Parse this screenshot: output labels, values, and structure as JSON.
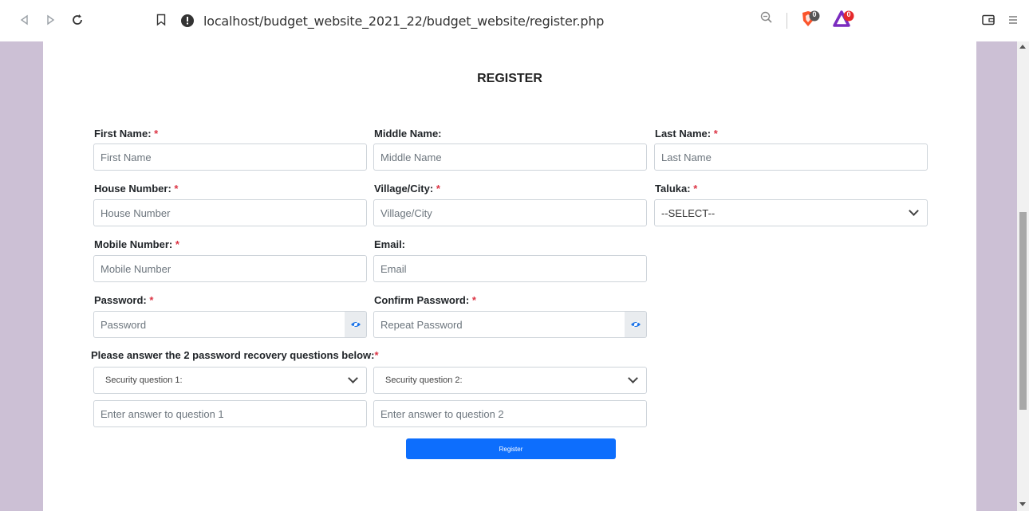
{
  "browser": {
    "url": "localhost/budget_website_2021_22/budget_website/register.php",
    "shield_badge": "0",
    "rewards_badge": "0"
  },
  "page": {
    "title": "REGISTER",
    "required_mark": "*"
  },
  "form": {
    "first_name": {
      "label": "First Name:",
      "placeholder": "First Name",
      "required": true
    },
    "middle_name": {
      "label": "Middle Name:",
      "placeholder": "Middle Name",
      "required": false
    },
    "last_name": {
      "label": "Last Name:",
      "placeholder": "Last Name",
      "required": true
    },
    "house_number": {
      "label": "House Number:",
      "placeholder": "House Number",
      "required": true
    },
    "village_city": {
      "label": "Village/City:",
      "placeholder": "Village/City",
      "required": true
    },
    "taluka": {
      "label": "Taluka:",
      "selected": "--SELECT--",
      "required": true
    },
    "mobile_number": {
      "label": "Mobile Number:",
      "placeholder": "Mobile Number",
      "required": true
    },
    "email": {
      "label": "Email:",
      "placeholder": "Email",
      "required": false
    },
    "password": {
      "label": "Password:",
      "placeholder": "Password",
      "required": true
    },
    "confirm_password": {
      "label": "Confirm Password:",
      "placeholder": "Repeat Password",
      "required": true
    },
    "recovery": {
      "label": "Please answer the 2 password recovery questions below:",
      "question1": {
        "selected": "Security question 1:",
        "answer_placeholder": "Enter answer to question 1"
      },
      "question2": {
        "selected": "Security question 2:",
        "answer_placeholder": "Enter answer to question 2"
      }
    },
    "submit_label": "Register"
  },
  "colors": {
    "page_background": "#ccc0d5",
    "primary_button": "#0d6efd",
    "required": "#dc3545",
    "eye_icon": "#1a73e8"
  }
}
